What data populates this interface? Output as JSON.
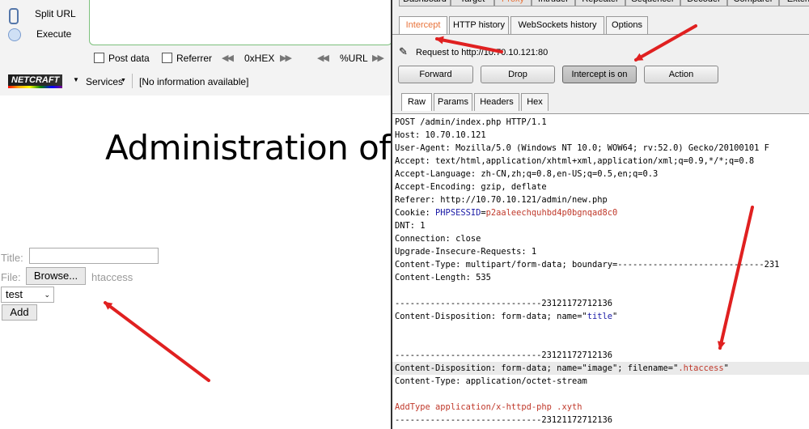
{
  "hackbar": {
    "split_url": "Split URL",
    "execute": "Execute",
    "post_data": "Post data",
    "referrer": "Referrer",
    "hex": "0xHEX",
    "url": "%URL"
  },
  "netcraft": {
    "logo": "NETCRAFT",
    "services": "Services",
    "info": "[No information available]"
  },
  "page": {
    "title": "Administration of m",
    "title_label": "Title:",
    "file_label": "File:",
    "browse": "Browse...",
    "file_name": "htaccess",
    "select_value": "test",
    "add": "Add"
  },
  "burp": {
    "top_tabs": [
      "Dashboard",
      "Target",
      "Proxy",
      "Intruder",
      "Repeater",
      "Sequencer",
      "Decoder",
      "Comparer",
      "Exten"
    ],
    "sub_tabs": [
      "Intercept",
      "HTTP history",
      "WebSockets history",
      "Options"
    ],
    "request_to": "Request to http://10.70.10.121:80",
    "buttons": {
      "forward": "Forward",
      "drop": "Drop",
      "intercept": "Intercept is on",
      "action": "Action"
    },
    "view_tabs": [
      "Raw",
      "Params",
      "Headers",
      "Hex"
    ],
    "request": [
      "POST /admin/index.php HTTP/1.1",
      "Host: 10.70.10.121",
      "User-Agent: Mozilla/5.0 (Windows NT 10.0; WOW64; rv:52.0) Gecko/20100101 F",
      "Accept: text/html,application/xhtml+xml,application/xml;q=0.9,*/*;q=0.8",
      "Accept-Language: zh-CN,zh;q=0.8,en-US;q=0.5,en;q=0.3",
      "Accept-Encoding: gzip, deflate",
      "Referer: http://10.70.10.121/admin/new.php",
      "Cookie: ",
      "DNT: 1",
      "Connection: close",
      "Upgrade-Insecure-Requests: 1",
      "Content-Type: multipart/form-data; boundary=-----------------------------231",
      "Content-Length: 535",
      "",
      "-----------------------------23121172712136",
      "Content-Disposition: form-data; name=\"",
      "",
      "",
      "-----------------------------23121172712136",
      "Content-Disposition: form-data; name=\"image\"; filename=\"",
      "Content-Type: application/octet-stream",
      "",
      "AddType application/x-httpd-php .xyth",
      "-----------------------------23121172712136"
    ],
    "cookie_name": "PHPSESSID",
    "cookie_value": "p2aaleechquhbd4p0bgnqad8c0",
    "title_field": "title",
    "filename": ".htaccess",
    "colors": {
      "active_tab": "#e8733a",
      "blue": "#1a1aa6",
      "red": "#c0392b",
      "arrow": "#e02020"
    }
  }
}
